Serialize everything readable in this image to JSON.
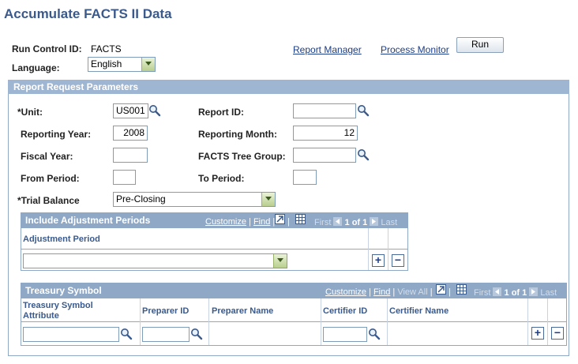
{
  "page": {
    "title": "Accumulate FACTS II Data"
  },
  "run_control": {
    "label": "Run Control ID:",
    "value": "FACTS",
    "language_label": "Language:",
    "language_value": "English",
    "report_manager_link": "Report Manager",
    "process_monitor_link": "Process Monitor",
    "run_button": "Run"
  },
  "report_params": {
    "section_title": "Report Request Parameters",
    "unit_label": "*Unit:",
    "unit_value": "US001",
    "report_id_label": "Report ID:",
    "report_id_value": "",
    "reporting_year_label": "Reporting Year:",
    "reporting_year_value": "2008",
    "reporting_month_label": "Reporting Month:",
    "reporting_month_value": "12",
    "fiscal_year_label": "Fiscal Year:",
    "fiscal_year_value": "",
    "facts_tree_group_label": "FACTS Tree Group:",
    "facts_tree_group_value": "",
    "from_period_label": "From Period:",
    "from_period_value": "",
    "to_period_label": "To Period:",
    "to_period_value": "",
    "trial_balance_label": "*Trial Balance",
    "trial_balance_value": "Pre-Closing"
  },
  "adjustment_grid": {
    "title": "Include Adjustment Periods",
    "customize": "Customize",
    "separator": "|",
    "find": "Find",
    "first": "First",
    "count": "1 of 1",
    "last": "Last",
    "column_header": "Adjustment Period",
    "row_value": ""
  },
  "treasury_grid": {
    "title": "Treasury Symbol",
    "customize": "Customize",
    "separator": "|",
    "find": "Find",
    "view_all": "View All",
    "first": "First",
    "count": "1 of 1",
    "last": "Last",
    "columns": {
      "tsa_line1": "Treasury Symbol",
      "tsa_line2": "Attribute",
      "preparer_id": "Preparer ID",
      "preparer_name": "Preparer Name",
      "certifier_id": "Certifier ID",
      "certifier_name": "Certifier Name"
    },
    "row": {
      "tsa_value": "",
      "preparer_id_value": "",
      "certifier_id_value": ""
    }
  },
  "colors": {
    "title": "#3a5a8c",
    "section_header": "#9fb6d3",
    "grid_header": "#8fa8c6",
    "link": "#1a3c8a"
  },
  "icons": [
    "lookup-icon",
    "dropdown-arrow-icon",
    "download-icon",
    "grid-view-icon",
    "first-arrow-icon",
    "last-arrow-icon",
    "add-row-icon",
    "delete-row-icon"
  ]
}
